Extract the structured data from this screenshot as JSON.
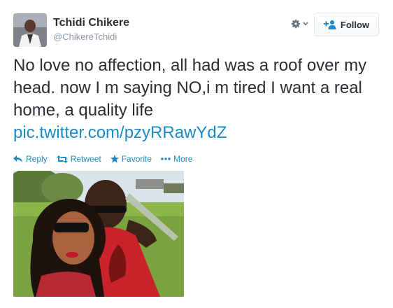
{
  "user": {
    "name": "Tchidi Chikere",
    "handle": "@ChikereTchidi",
    "avatar_icon": "user-avatar"
  },
  "header": {
    "gear_icon": "gear-icon",
    "follow_label": "Follow"
  },
  "tweet": {
    "text": "No love no affection, all had was a roof over my head. now I m saying NO,i m tired I want a real home, a quality life",
    "link": "pic.twitter.com/pzyRRawYdZ"
  },
  "actions": [
    {
      "label": "Reply",
      "icon": "reply-icon"
    },
    {
      "label": "Retweet",
      "icon": "retweet-icon"
    },
    {
      "label": "Favorite",
      "icon": "star-icon"
    },
    {
      "label": "More",
      "icon": "more-icon"
    }
  ],
  "photo": {
    "subject": "photo"
  },
  "colors": {
    "link": "#1a8bc4",
    "text": "#292f33",
    "muted": "#8899a6"
  }
}
